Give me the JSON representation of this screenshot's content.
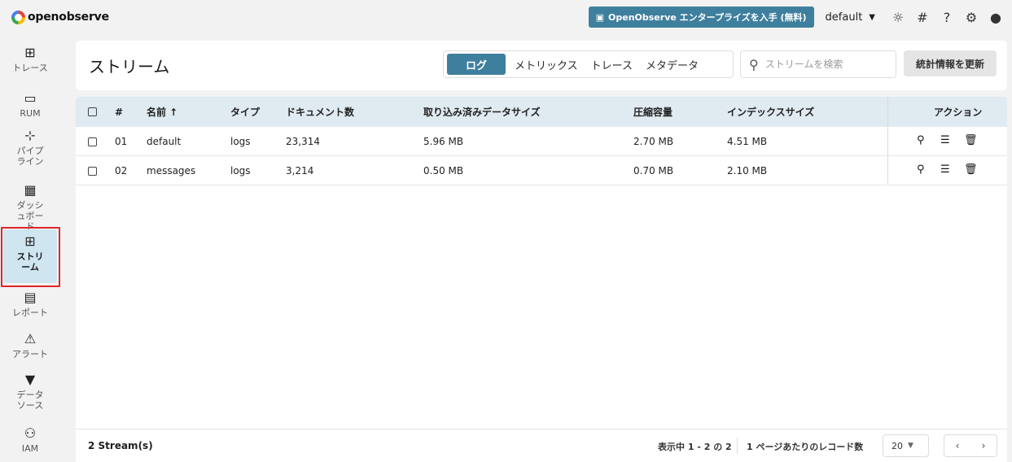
{
  "app": {
    "logo_text": "openobserve"
  },
  "topbar": {
    "enterprise_label": "OpenObserve エンタープライズを入手 (無料)",
    "org_name": "default"
  },
  "sidebar": {
    "items": [
      {
        "label": "トレース"
      },
      {
        "label": "RUM"
      },
      {
        "label": "パイプライン"
      },
      {
        "label": "ダッシュボード"
      },
      {
        "label": "ストリーム"
      },
      {
        "label": "レポート"
      },
      {
        "label": "アラート"
      },
      {
        "label": "データソース"
      },
      {
        "label": "IAM"
      }
    ]
  },
  "header": {
    "title": "ストリーム",
    "tabs": [
      {
        "label": "ログ"
      },
      {
        "label": "メトリックス"
      },
      {
        "label": "トレース"
      },
      {
        "label": "メタデータ"
      }
    ],
    "search_placeholder": "ストリームを検索",
    "refresh_label": "統計情報を更新"
  },
  "table": {
    "columns": {
      "num": "#",
      "name": "名前 ↑",
      "type": "タイプ",
      "docs": "ドキュメント数",
      "ingested": "取り込み済みデータサイズ",
      "compressed": "圧縮容量",
      "index": "インデックスサイズ",
      "actions": "アクション"
    },
    "rows": [
      {
        "num": "01",
        "name": "default",
        "type": "logs",
        "docs": "23,314",
        "ingested": "5.96 MB",
        "compressed": "2.70 MB",
        "index": "4.51 MB"
      },
      {
        "num": "02",
        "name": "messages",
        "type": "logs",
        "docs": "3,214",
        "ingested": "0.50 MB",
        "compressed": "0.70 MB",
        "index": "2.10 MB"
      }
    ]
  },
  "footer": {
    "stream_count": "2 Stream(s)",
    "showing": "表示中 1 - 2 の 2",
    "per_page_label": "1 ページあたりのレコード数",
    "per_page_value": "20"
  }
}
